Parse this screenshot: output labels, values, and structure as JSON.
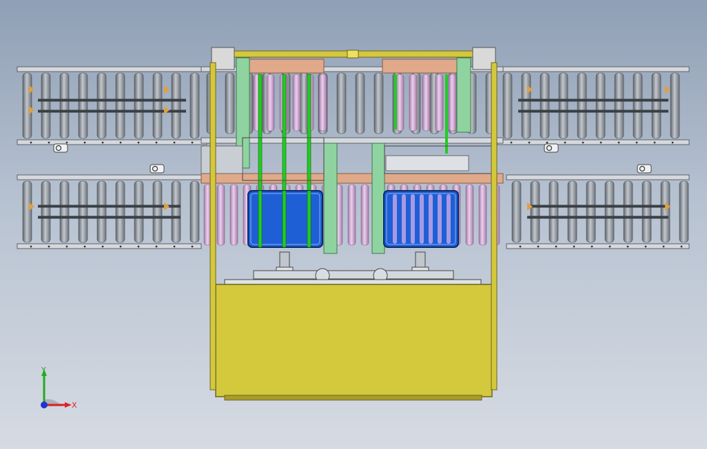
{
  "viewport": {
    "background_top": "#8f9fb5",
    "background_bottom": "#d6dbe3"
  },
  "colors": {
    "roller": "#8e959d",
    "roller_highlight": "#c3c8cd",
    "rail": "#5a5f66",
    "frame_yellow": "#d4c83c",
    "frame_outline": "#6b6420",
    "bin_blue": "#1f5fd6",
    "green_post": "#8fd4a0",
    "bright_green": "#22cc22",
    "salmon": "#e0a98a",
    "pink_roller": "#d4a8d8",
    "orange_bracket": "#e0a040"
  },
  "triad": {
    "y_label": "Y",
    "x_label": "X",
    "y_color": "#22aa22",
    "x_color": "#dd2222",
    "z_color": "#2233cc"
  }
}
